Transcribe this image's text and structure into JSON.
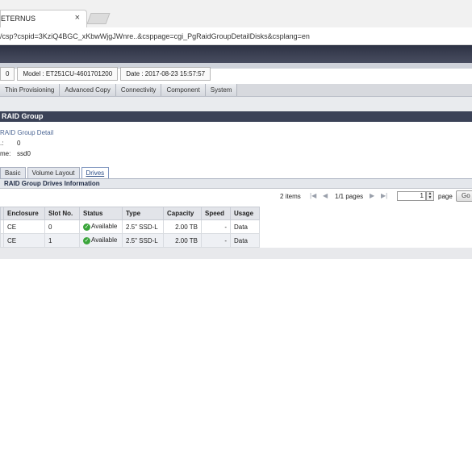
{
  "browser": {
    "tab_title": "ETERNUS",
    "tab_close": "×",
    "url": "/csp?cspid=3KziQ4BGC_xKbwWjgJWnre..&csppage=cgi_PgRaidGroupDetailDisks&csplang=en"
  },
  "header": {
    "serial": "0",
    "model": "Model : ET251CU-4601701200",
    "date": "Date : 2017-08-23 15:57:57"
  },
  "nav_tabs": [
    "Thin Provisioning",
    "Advanced Copy",
    "Connectivity",
    "Component",
    "System"
  ],
  "section": {
    "title": "RAID Group",
    "detail_heading": "RAID Group Detail",
    "no_label": ".:",
    "no_value": "0",
    "name_label": "me:",
    "name_value": "ssd0"
  },
  "sub_tabs": [
    {
      "label": "Basic",
      "active": false
    },
    {
      "label": "Volume Layout",
      "active": false
    },
    {
      "label": "Drives",
      "active": true
    }
  ],
  "panel": {
    "title": "RAID Group Drives Information",
    "items": "2 items",
    "pages": "1/1 pages",
    "current_page": "1",
    "page_label": "page",
    "go_label": "Go"
  },
  "table": {
    "headers": [
      "Enclosure",
      "Slot No.",
      "Status",
      "Type",
      "Capacity",
      "Speed",
      "Usage"
    ],
    "rows": [
      {
        "enclosure": "CE",
        "slot": "0",
        "status": "Available",
        "type": "2.5\" SSD-L",
        "capacity": "2.00 TB",
        "speed": "-",
        "usage": "Data"
      },
      {
        "enclosure": "CE",
        "slot": "1",
        "status": "Available",
        "type": "2.5\" SSD-L",
        "capacity": "2.00 TB",
        "speed": "-",
        "usage": "Data"
      }
    ]
  },
  "colors": {
    "header_dark": "#3b4257",
    "status_ok": "#3aa53a",
    "link_blue": "#4a6493"
  }
}
